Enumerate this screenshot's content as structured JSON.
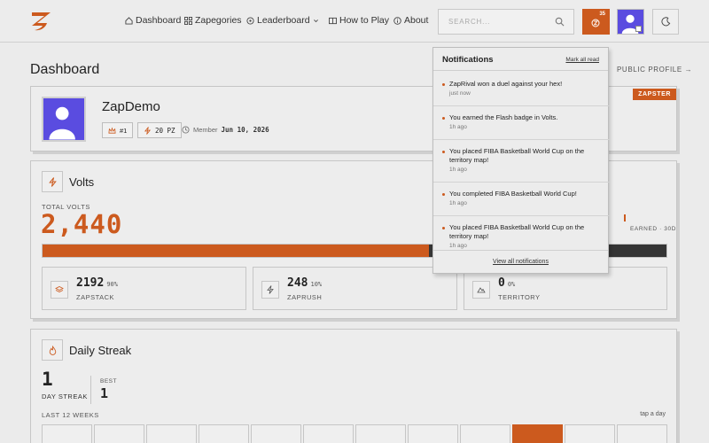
{
  "header": {
    "nav": [
      {
        "label": "Dashboard",
        "icon": "home-icon"
      },
      {
        "label": "Zapegories",
        "icon": "grid-icon"
      },
      {
        "label": "Leaderboard",
        "icon": "trophy-icon"
      },
      {
        "label": "How to Play",
        "icon": "book-icon"
      },
      {
        "label": "About",
        "icon": "info-icon"
      }
    ],
    "search_placeholder": "SEARCH...",
    "notification_count": "35"
  },
  "page": {
    "title": "Dashboard",
    "public_profile": "PUBLIC PROFILE →"
  },
  "profile": {
    "username": "ZapDemo",
    "rank_chip": "#1",
    "points_chip": "20 PZ",
    "member_label": "Member",
    "member_date": "Jun 10, 2026",
    "badge": "ZAPSTER"
  },
  "volts": {
    "title": "Volts",
    "total_label": "TOTAL VOLTS",
    "total_value": "2,440",
    "earned_label": "EARNED · 30D",
    "bar_fraction": 0.62,
    "stats": [
      {
        "value": "2192",
        "pct": "90%",
        "label": "ZAPSTACK",
        "icon": "stack-icon"
      },
      {
        "value": "248",
        "pct": "10%",
        "label": "ZAPRUSH",
        "icon": "bolt-icon"
      },
      {
        "value": "0",
        "pct": "0%",
        "label": "TERRITORY",
        "icon": "map-icon"
      }
    ]
  },
  "streak": {
    "title": "Daily Streak",
    "current_value": "1",
    "current_label": "DAY STREAK",
    "best_label": "BEST",
    "best_value": "1",
    "weeks_label": "LAST 12 WEEKS",
    "tap_hint": "tap a day",
    "active_week_index": 9
  },
  "notifications": {
    "title": "Notifications",
    "mark_all": "Mark all read",
    "view_all": "View all notifications",
    "items": [
      {
        "message": "ZapRival won a duel against your hex!",
        "time": "just now"
      },
      {
        "message": "You earned the Flash badge in Volts.",
        "time": "1h ago"
      },
      {
        "message": "You placed FIBA Basketball World Cup on the territory map!",
        "time": "1h ago"
      },
      {
        "message": "You completed FIBA Basketball World Cup!",
        "time": "1h ago"
      },
      {
        "message": "You placed FIBA Basketball World Cup on the territory map!",
        "time": "1h ago"
      }
    ]
  },
  "colors": {
    "accent": "#cc5a1e",
    "avatar": "#5a4ce0",
    "bar_track": "#353535"
  }
}
